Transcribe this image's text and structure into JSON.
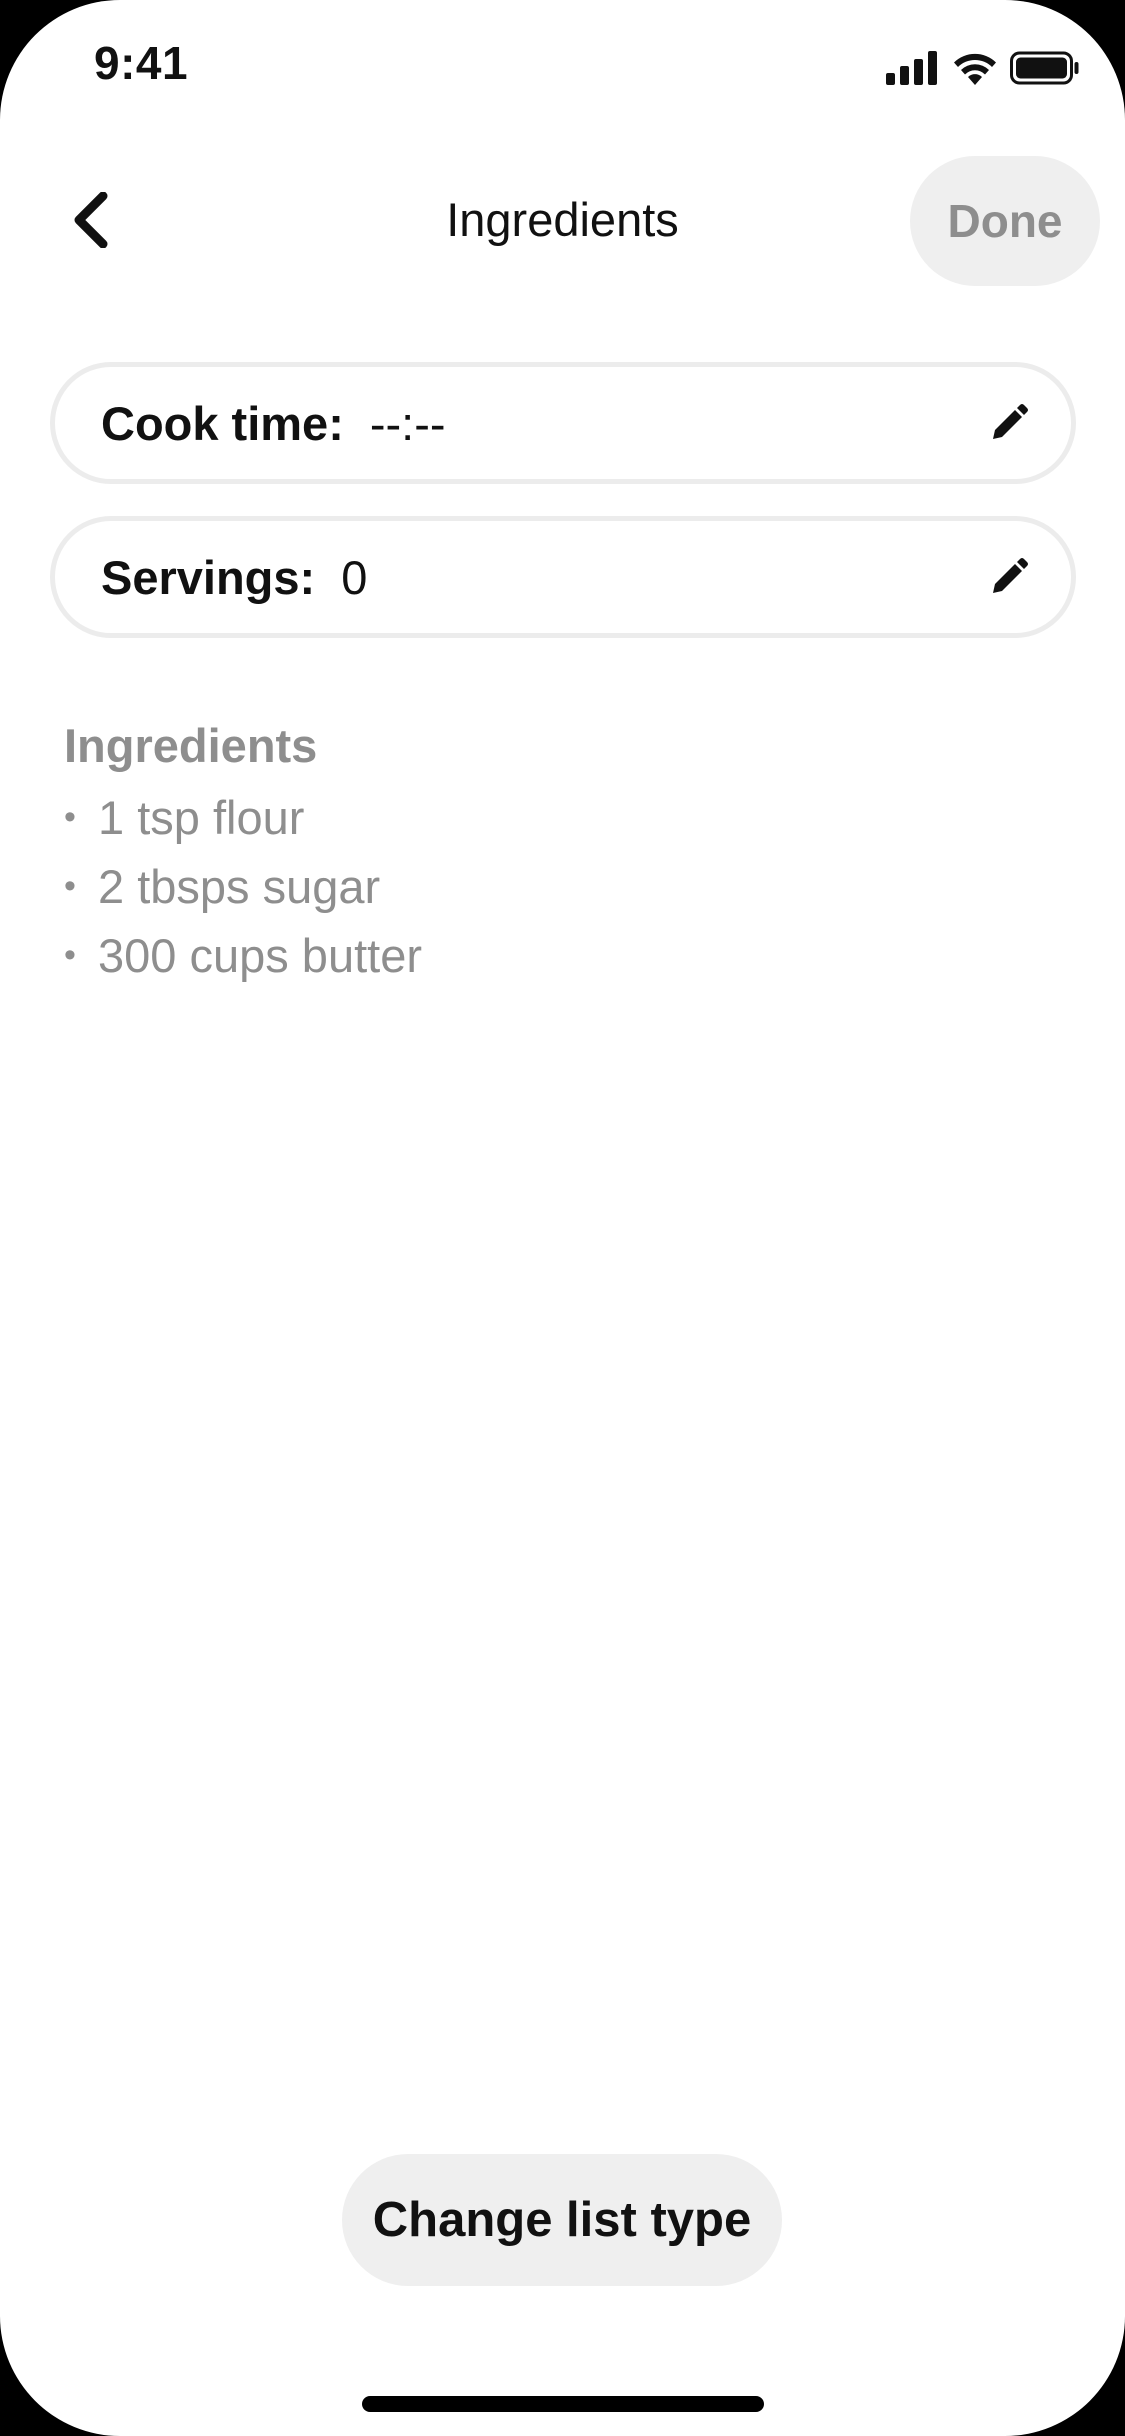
{
  "status_bar": {
    "time": "9:41",
    "icons": [
      "cellular-signal-icon",
      "wifi-icon",
      "battery-icon"
    ]
  },
  "header": {
    "back_icon": "chevron-left-icon",
    "title": "Ingredients",
    "done_label": "Done"
  },
  "fields": {
    "cook_time": {
      "label": "Cook time:",
      "value": "--:--",
      "icon": "pencil-icon"
    },
    "servings": {
      "label": "Servings:",
      "value": "0",
      "icon": "pencil-icon"
    }
  },
  "ingredients": {
    "heading": "Ingredients",
    "bullet": "•",
    "items": [
      "1 tsp flour",
      "2 tbsps sugar",
      "300 cups butter"
    ]
  },
  "bottom": {
    "change_list_label": "Change list type"
  },
  "colors": {
    "text_primary": "#111111",
    "text_muted": "#8e8e8e",
    "pill_background": "#efefef",
    "pill_border": "#ececec"
  }
}
